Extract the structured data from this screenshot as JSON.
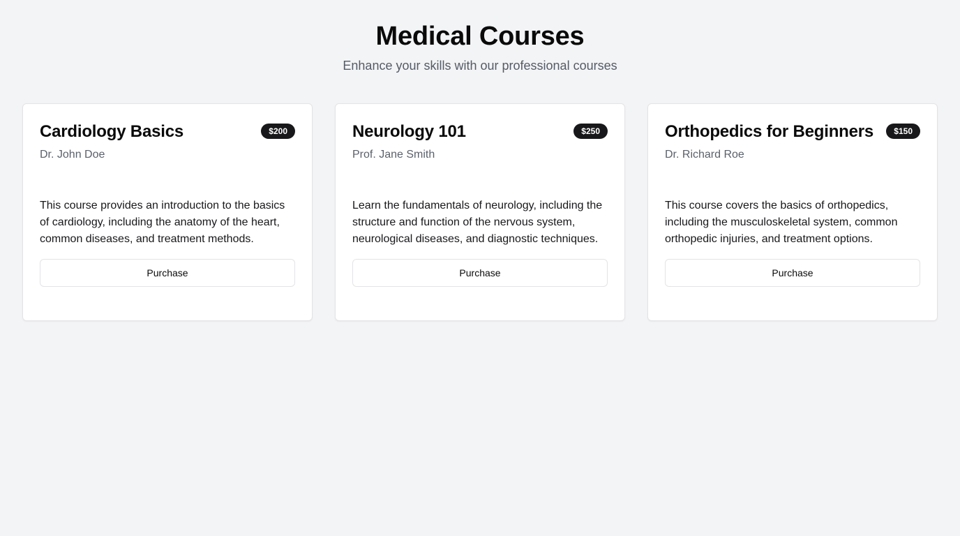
{
  "header": {
    "title": "Medical Courses",
    "subtitle": "Enhance your skills with our professional courses"
  },
  "courses": [
    {
      "title": "Cardiology Basics",
      "price": "$200",
      "instructor": "Dr. John Doe",
      "description": "This course provides an introduction to the basics of cardiology, including the anatomy of the heart, common diseases, and treatment methods.",
      "button_label": "Purchase"
    },
    {
      "title": "Neurology 101",
      "price": "$250",
      "instructor": "Prof. Jane Smith",
      "description": "Learn the fundamentals of neurology, including the structure and function of the nervous system, neurological diseases, and diagnostic techniques.",
      "button_label": "Purchase"
    },
    {
      "title": "Orthopedics for Beginners",
      "price": "$150",
      "instructor": "Dr. Richard Roe",
      "description": "This course covers the basics of orthopedics, including the musculoskeletal system, common orthopedic injuries, and treatment options.",
      "button_label": "Purchase"
    }
  ],
  "colors": {
    "background": "#f3f4f6",
    "card": "#ffffff",
    "badge": "#18181b",
    "muted_text": "#5b616b"
  }
}
